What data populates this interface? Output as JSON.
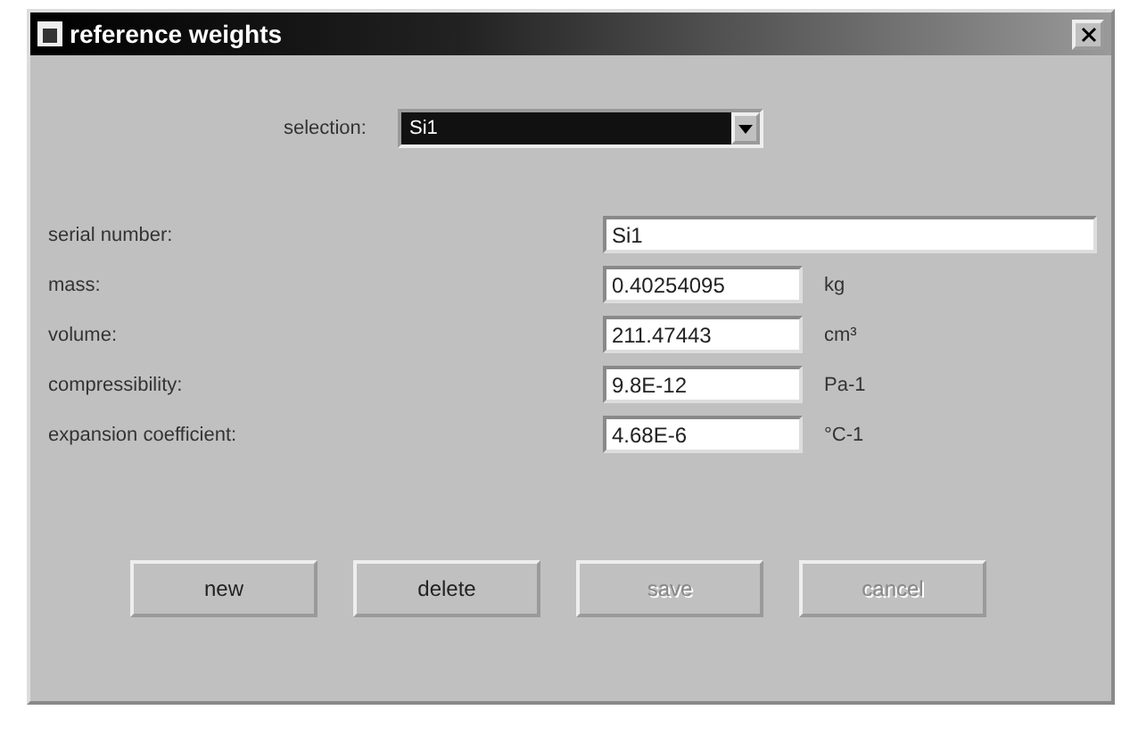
{
  "window": {
    "title": "reference weights"
  },
  "selection": {
    "label": "selection:",
    "value": "Si1"
  },
  "fields": [
    {
      "label": "serial number:",
      "value": "Si1",
      "wide": true
    },
    {
      "label": "mass:",
      "value": "0.40254095",
      "unit": "kg",
      "wide": false
    },
    {
      "label": "volume:",
      "value": "211.47443",
      "unit": "cm³",
      "wide": false
    },
    {
      "label": "compressibility:",
      "value": "9.8E-12",
      "unit": "Pa-1",
      "wide": false
    },
    {
      "label": "expansion coefficient:",
      "value": "4.68E-6",
      "unit": "°C-1",
      "wide": false
    }
  ],
  "buttons": [
    {
      "label": "new",
      "disabled": false
    },
    {
      "label": "delete",
      "disabled": false
    },
    {
      "label": "save",
      "disabled": true
    },
    {
      "label": "cancel",
      "disabled": true
    }
  ]
}
